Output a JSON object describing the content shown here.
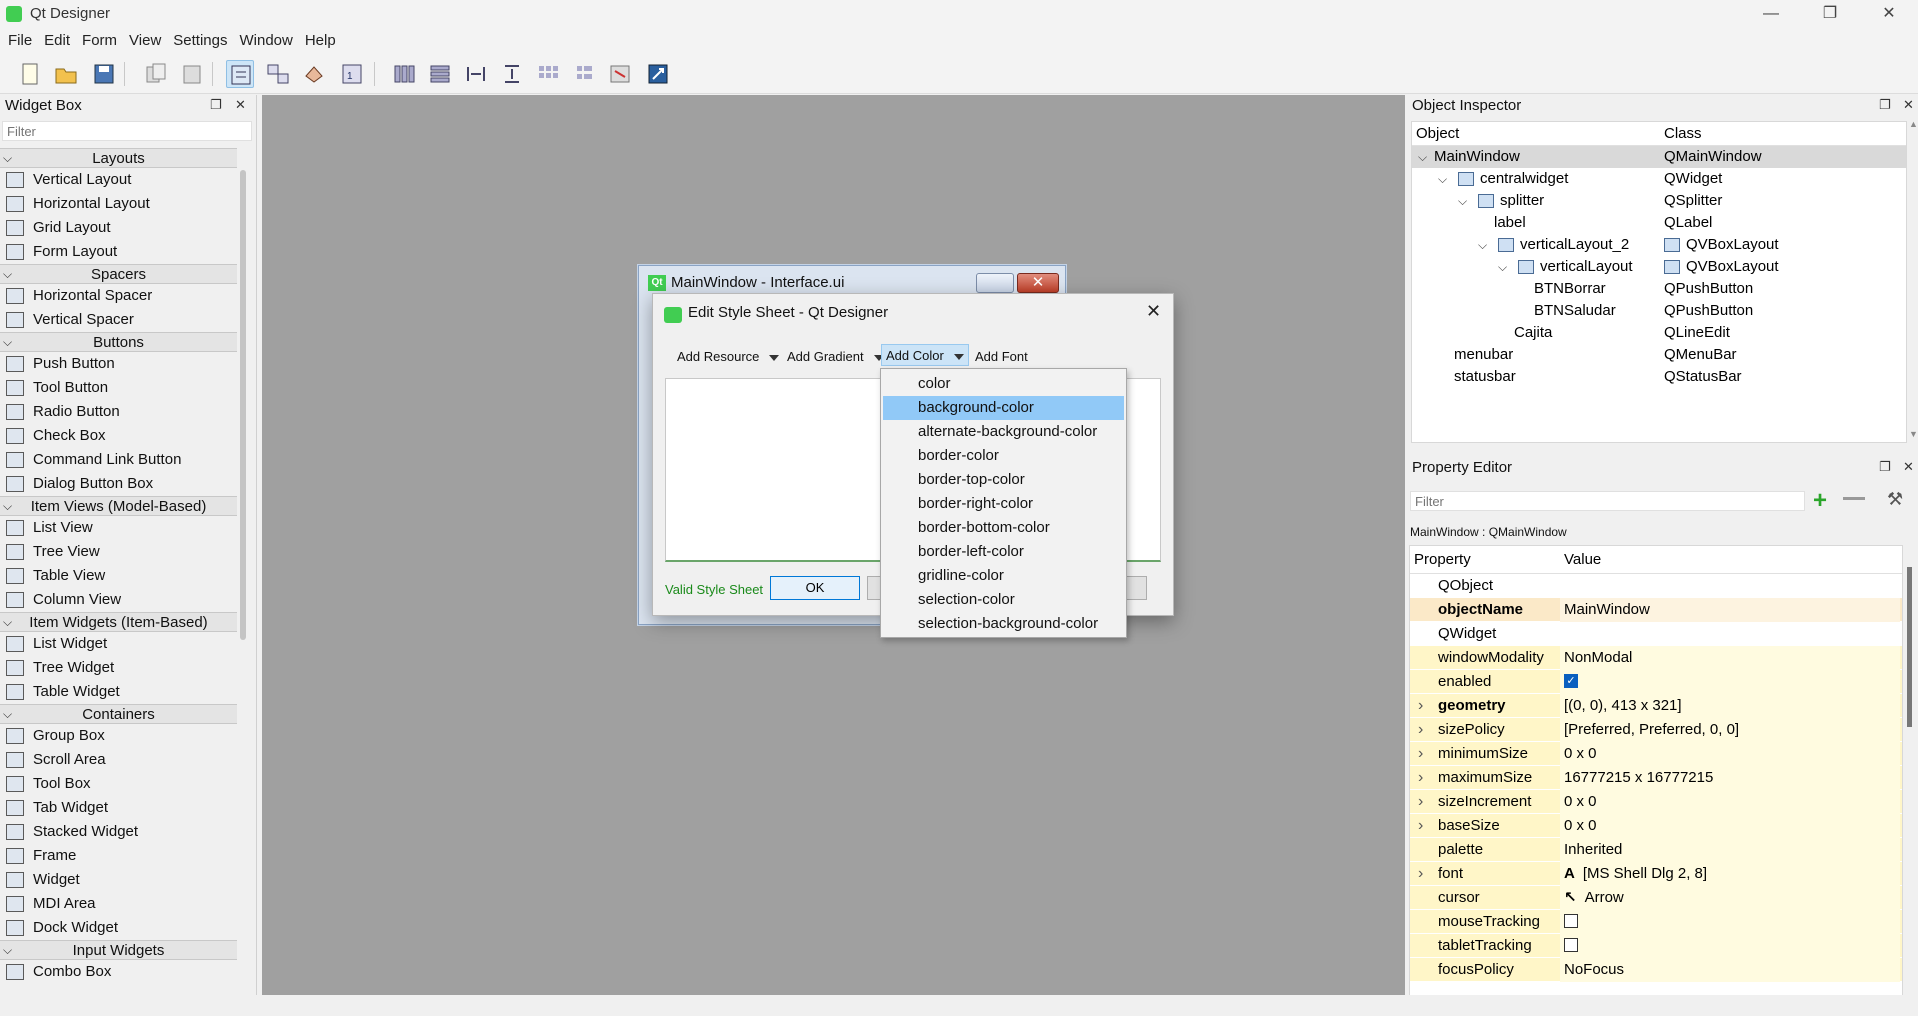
{
  "app": {
    "title": "Qt Designer",
    "window_controls": {
      "minimize": "—",
      "restore": "❐",
      "close": "✕"
    }
  },
  "menu": [
    "File",
    "Edit",
    "Form",
    "View",
    "Settings",
    "Window",
    "Help"
  ],
  "toolbar_icons": [
    "new-form-icon",
    "open-form-icon",
    "save-form-icon",
    "copy-icon",
    "paste-icon",
    "edit-widgets-icon",
    "edit-signals-slots-icon",
    "edit-buddies-icon",
    "edit-tab-order-icon",
    "lay-out-horizontally-icon",
    "lay-out-vertically-icon",
    "lay-out-horizontal-splitter-icon",
    "lay-out-vertical-splitter-icon",
    "lay-out-grid-icon",
    "lay-out-form-icon",
    "break-layout-icon",
    "adjust-size-icon"
  ],
  "widget_box": {
    "title": "Widget Box",
    "filter_placeholder": "Filter",
    "categories": [
      {
        "name": "Layouts",
        "items": [
          "Vertical Layout",
          "Horizontal Layout",
          "Grid Layout",
          "Form Layout"
        ]
      },
      {
        "name": "Spacers",
        "items": [
          "Horizontal Spacer",
          "Vertical Spacer"
        ]
      },
      {
        "name": "Buttons",
        "items": [
          "Push Button",
          "Tool Button",
          "Radio Button",
          "Check Box",
          "Command Link Button",
          "Dialog Button Box"
        ]
      },
      {
        "name": "Item Views (Model-Based)",
        "items": [
          "List View",
          "Tree View",
          "Table View",
          "Column View"
        ]
      },
      {
        "name": "Item Widgets (Item-Based)",
        "items": [
          "List Widget",
          "Tree Widget",
          "Table Widget"
        ]
      },
      {
        "name": "Containers",
        "items": [
          "Group Box",
          "Scroll Area",
          "Tool Box",
          "Tab Widget",
          "Stacked Widget",
          "Frame",
          "Widget",
          "MDI Area",
          "Dock Widget"
        ]
      },
      {
        "name": "Input Widgets",
        "items": [
          "Combo Box"
        ]
      }
    ]
  },
  "form_window": {
    "title": "MainWindow - Interface.ui",
    "icon_text": "Qt"
  },
  "dialog": {
    "title": "Edit Style Sheet - Qt Designer",
    "toolbar": {
      "add_resource": "Add Resource",
      "add_gradient": "Add Gradient",
      "add_color": "Add Color",
      "add_font": "Add Font"
    },
    "status": "Valid Style Sheet",
    "ok": "OK"
  },
  "color_menu": {
    "items": [
      "color",
      "background-color",
      "alternate-background-color",
      "border-color",
      "border-top-color",
      "border-right-color",
      "border-bottom-color",
      "border-left-color",
      "gridline-color",
      "selection-color",
      "selection-background-color"
    ],
    "highlighted": "background-color"
  },
  "object_inspector": {
    "title": "Object Inspector",
    "col_object": "Object",
    "col_class": "Class",
    "rows": [
      {
        "name": "MainWindow",
        "cls": "QMainWindow",
        "depth": 0,
        "expander": true,
        "icon": false,
        "selected": true
      },
      {
        "name": "centralwidget",
        "cls": "QWidget",
        "depth": 1,
        "expander": true,
        "icon": true
      },
      {
        "name": "splitter",
        "cls": "QSplitter",
        "depth": 2,
        "expander": true,
        "icon": true
      },
      {
        "name": "label",
        "cls": "QLabel",
        "depth": 3,
        "expander": false,
        "icon": false
      },
      {
        "name": "verticalLayout_2",
        "cls": "QVBoxLayout",
        "depth": 3,
        "expander": true,
        "icon": true,
        "cls_icon": true
      },
      {
        "name": "verticalLayout",
        "cls": "QVBoxLayout",
        "depth": 4,
        "expander": true,
        "icon": true,
        "cls_icon": true
      },
      {
        "name": "BTNBorrar",
        "cls": "QPushButton",
        "depth": 5,
        "expander": false,
        "icon": false
      },
      {
        "name": "BTNSaludar",
        "cls": "QPushButton",
        "depth": 5,
        "expander": false,
        "icon": false
      },
      {
        "name": "Cajita",
        "cls": "QLineEdit",
        "depth": 4,
        "expander": false,
        "icon": false
      },
      {
        "name": "menubar",
        "cls": "QMenuBar",
        "depth": 1,
        "expander": false,
        "icon": false
      },
      {
        "name": "statusbar",
        "cls": "QStatusBar",
        "depth": 1,
        "expander": false,
        "icon": false
      }
    ]
  },
  "property_editor": {
    "title": "Property Editor",
    "filter_placeholder": "Filter",
    "object_label": "MainWindow : QMainWindow",
    "col_property": "Property",
    "col_value": "Value",
    "rows": [
      {
        "kind": "group",
        "name": "QObject"
      },
      {
        "kind": "beige",
        "name": "objectName",
        "value": "MainWindow",
        "bold": true
      },
      {
        "kind": "group",
        "name": "QWidget"
      },
      {
        "kind": "yel",
        "name": "windowModality",
        "value": "NonModal"
      },
      {
        "kind": "yel",
        "name": "enabled",
        "check": true
      },
      {
        "kind": "yel",
        "name": "geometry",
        "value": "[(0, 0), 413 x 321]",
        "bold": true,
        "expander": true
      },
      {
        "kind": "yel",
        "name": "sizePolicy",
        "value": "[Preferred, Preferred, 0, 0]",
        "expander": true
      },
      {
        "kind": "yel",
        "name": "minimumSize",
        "value": "0 x 0",
        "expander": true
      },
      {
        "kind": "yel",
        "name": "maximumSize",
        "value": "16777215 x 16777215",
        "expander": true
      },
      {
        "kind": "yel",
        "name": "sizeIncrement",
        "value": "0 x 0",
        "expander": true
      },
      {
        "kind": "yel",
        "name": "baseSize",
        "value": "0 x 0",
        "expander": true
      },
      {
        "kind": "yel",
        "name": "palette",
        "value": "Inherited"
      },
      {
        "kind": "yel",
        "name": "font",
        "value": "[MS Shell Dlg 2, 8]",
        "expander": true,
        "prefix": "A"
      },
      {
        "kind": "yel",
        "name": "cursor",
        "value": "Arrow",
        "prefix": "↖"
      },
      {
        "kind": "yel",
        "name": "mouseTracking",
        "check": false
      },
      {
        "kind": "yel",
        "name": "tabletTracking",
        "check": false
      },
      {
        "kind": "yel",
        "name": "focusPolicy",
        "value": "NoFocus"
      }
    ]
  }
}
